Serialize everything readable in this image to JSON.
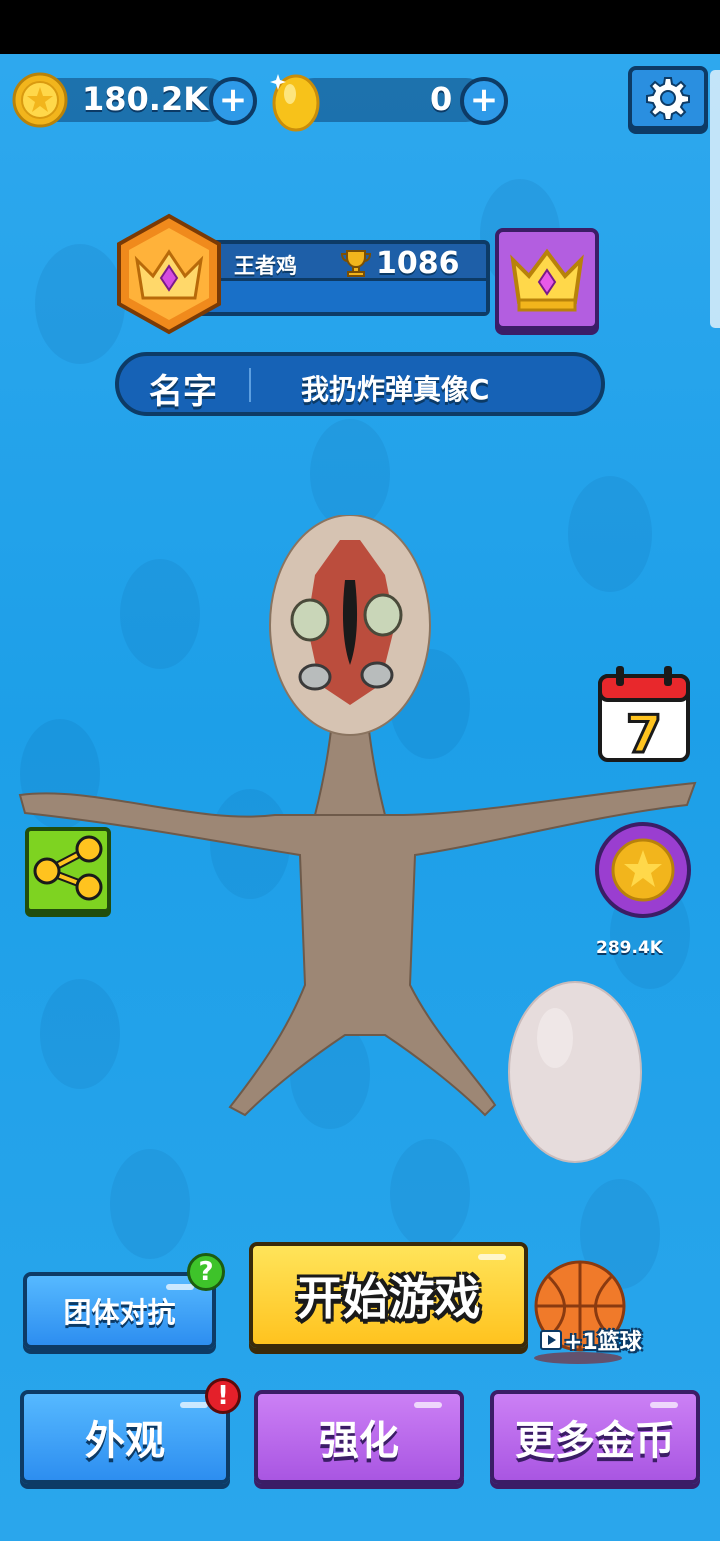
{
  "currency": {
    "gold_coins": "180.2K",
    "gems": "0"
  },
  "rank": {
    "title": "王者鸡",
    "trophies": "1086"
  },
  "player": {
    "name_label": "名字",
    "name_value": "我扔炸弹真像C"
  },
  "side": {
    "calendar_day": "7",
    "coin_reward": "289.4K"
  },
  "buttons": {
    "team_battle": "团体对抗",
    "start_game": "开始游戏",
    "skin": "外观",
    "upgrade": "强化",
    "more_coins": "更多金币",
    "team_badge": "?",
    "skin_badge": "!",
    "basketball_reward": "+1篮球"
  },
  "colors": {
    "background": "#2aa3ea",
    "start_button": "#ffc31f",
    "purple_button": "#a956e2",
    "blue_button": "#2d8ef0",
    "outline": "#0d3b66"
  },
  "icons": [
    "coin-icon",
    "gem-icon",
    "plus-icon",
    "gear-icon",
    "rank-crown-badge-icon",
    "trophy-icon",
    "crown-icon",
    "calendar-icon",
    "share-icon",
    "purple-coin-icon",
    "basketball-icon",
    "play-video-icon",
    "question-icon",
    "exclamation-icon"
  ]
}
